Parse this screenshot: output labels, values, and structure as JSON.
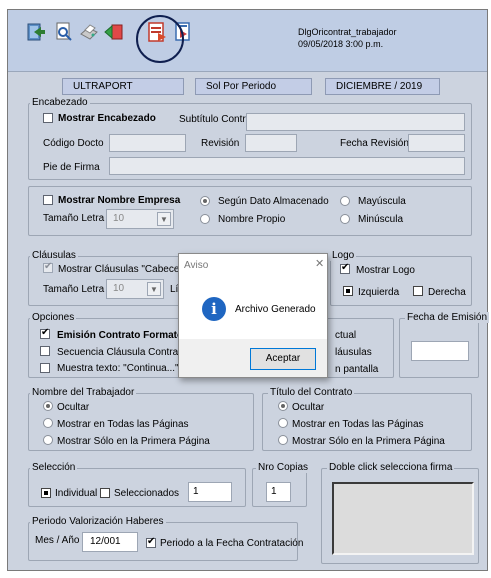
{
  "toolbar": {
    "icons": [
      "exit-icon",
      "print-preview-icon",
      "print-icon",
      "previous-icon",
      "generate-document-icon",
      "export-icon"
    ],
    "app_name": "DlgOricontrat_trabajador",
    "datetime": "09/05/2018 3:00 p.m."
  },
  "header": {
    "company": "ULTRAPORT",
    "period_type": "Sol Por Periodo",
    "period": "DICIEMBRE / 2019"
  },
  "encabezado": {
    "title": "Encabezado",
    "show_header_label": "Mostrar Encabezado",
    "subtitle_label": "Subtítulo Contrato",
    "subtitle_value": "",
    "code_label": "Código Docto",
    "code_value": "",
    "revision_label": "Revisión",
    "revision_value": "",
    "rev_date_label": "Fecha Revisión",
    "rev_date_value": "",
    "footer_label": "Pie de Firma",
    "footer_value": ""
  },
  "empresa": {
    "show_company_label": "Mostrar Nombre Empresa",
    "font_size_label": "Tamaño Letra",
    "font_size_value": "10",
    "radio_stored": "Según Dato Almacenado",
    "radio_proper": "Nombre Propio",
    "radio_upper": "Mayúscula",
    "radio_lower": "Minúscula"
  },
  "clausulas": {
    "title": "Cláusulas",
    "show_clauses_label": "Mostrar Cláusulas \"Cabeceras",
    "font_size_label": "Tamaño Letra",
    "font_size_value": "10",
    "line_label": "Lí"
  },
  "logo": {
    "title": "Logo",
    "show_logo_label": "Mostrar Logo",
    "left_label": "Izquierda",
    "right_label": "Derecha"
  },
  "opciones": {
    "title": "Opciones",
    "opt1_label": "Emisión Contrato Formato Están",
    "opt2_label": "Secuencia Cláusula Contrato Es",
    "opt3_label": "Muestra texto: \"Continua...\"",
    "right1": "ctual",
    "right2": "láusulas",
    "right3": "n pantalla"
  },
  "fecha_emision": {
    "title": "Fecha de Emisión",
    "value": ""
  },
  "trabajador": {
    "title": "Nombre del Trabajador",
    "r1": "Ocultar",
    "r2": "Mostrar en Todas las Páginas",
    "r3": "Mostrar Sólo en la Primera Página"
  },
  "titulo_contrato": {
    "title": "Título del Contrato",
    "r1": "Ocultar",
    "r2": "Mostrar en Todas las Páginas",
    "r3": "Mostrar Sólo en la Primera Página"
  },
  "seleccion": {
    "title": "Selección",
    "individual": "Individual",
    "selected": "Seleccionados",
    "value": "1"
  },
  "copias": {
    "title": "Nro Copias",
    "value": "1"
  },
  "firma": {
    "title": "Doble click selecciona firma"
  },
  "periodo": {
    "title": "Periodo Valorización Haberes",
    "label": "Mes / Año",
    "value": "12/001",
    "check_label": "Periodo a la Fecha Contratación"
  },
  "dialog": {
    "title": "Aviso",
    "message": "Archivo Generado",
    "ok": "Aceptar",
    "close": "✕",
    "info": "i"
  },
  "colors": {
    "accent": "#0078d7",
    "panel": "#ccd3df",
    "toolbar": "#bfcde4"
  }
}
